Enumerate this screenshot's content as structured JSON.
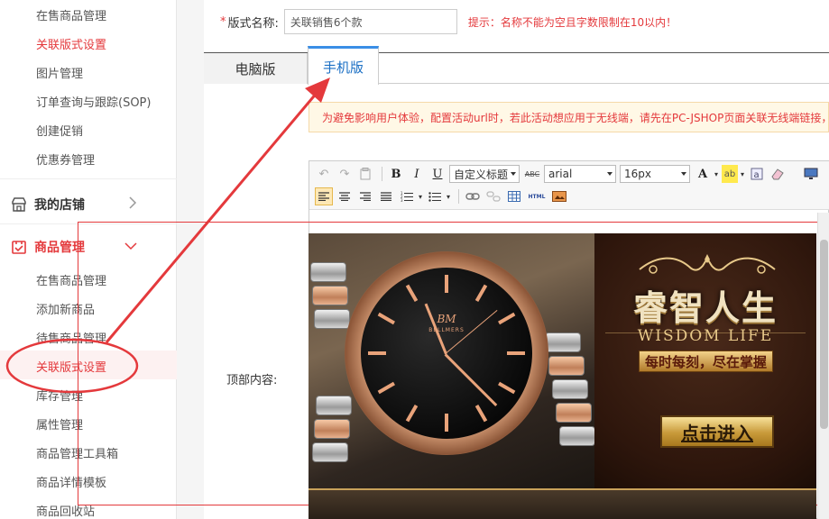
{
  "sidebar": {
    "top_items": [
      {
        "label": "在售商品管理"
      },
      {
        "label": "关联版式设置"
      },
      {
        "label": "图片管理"
      },
      {
        "label": "订单查询与跟踪(SOP)"
      },
      {
        "label": "创建促销"
      },
      {
        "label": "优惠券管理"
      }
    ],
    "groups": [
      {
        "title": "我的店铺",
        "icon": "store-icon",
        "expanded": false
      },
      {
        "title": "商品管理",
        "icon": "goods-icon",
        "expanded": true
      }
    ],
    "goods_items": [
      {
        "label": "在售商品管理"
      },
      {
        "label": "添加新商品"
      },
      {
        "label": "待售商品管理"
      },
      {
        "label": "关联版式设置"
      },
      {
        "label": "库存管理"
      },
      {
        "label": "属性管理"
      },
      {
        "label": "商品管理工具箱"
      },
      {
        "label": "商品详情模板"
      },
      {
        "label": "商品回收站"
      }
    ]
  },
  "form": {
    "required_mark": "*",
    "name_label": "版式名称:",
    "name_value": "关联销售6个款",
    "hint": "提示：名称不能为空且字数限制在10以内！",
    "top_content_label": "顶部内容:"
  },
  "tabs": [
    {
      "label": "电脑版",
      "active": false
    },
    {
      "label": "手机版",
      "active": true
    }
  ],
  "notice": "为避免影响用户体验，配置活动url时，若此活动想应用于无线端，请先在PC-JSHOP页面关联无线端链接，",
  "editor": {
    "heading_select": "自定义标题",
    "font_select": "arial",
    "size_select": "16px",
    "tool_icons": {
      "undo": "undo-icon",
      "redo": "redo-icon",
      "paste": "paste-icon",
      "bold": "B",
      "italic": "I",
      "underline": "U",
      "strike": "ABC",
      "font_color": "A",
      "highlight": "ab",
      "insert_image": "image-icon",
      "eraser": "eraser-icon",
      "preview": "monitor-icon",
      "html": "HTML"
    }
  },
  "banner": {
    "watch_brand_mark": "BM",
    "watch_brand": "BELLMERS",
    "slogan_cn": "睿智人生",
    "slogan_en": "WISDOM LIFE",
    "slogan_sub": "每时每刻，尽在掌握",
    "enter_button": "点击进入"
  },
  "colors": {
    "accent_red": "#e4393c",
    "tab_blue": "#3a8ee6",
    "notice_bg": "#fff8e6",
    "banner_gold": "#e8c98a"
  }
}
